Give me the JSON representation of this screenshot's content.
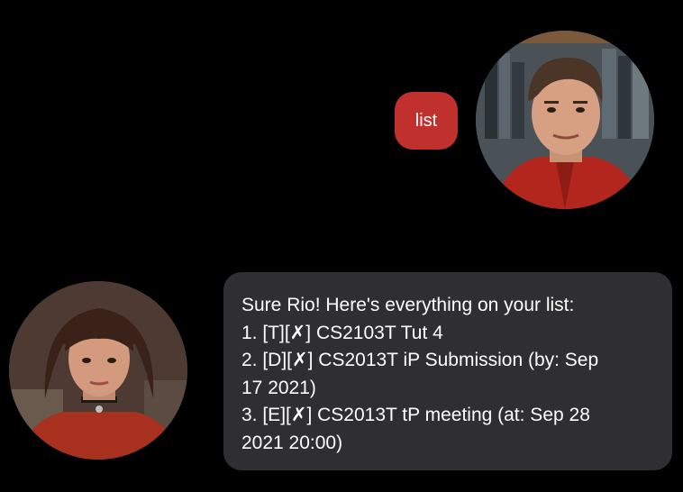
{
  "user_message": {
    "text": "list",
    "color": "#c0302c"
  },
  "bot_message": {
    "color": "#2f2f33",
    "lines": [
      "Sure Rio! Here's everything on your list:",
      "1. [T][✗] CS2103T Tut 4",
      "2. [D][✗] CS2013T iP Submission (by: Sep",
      "17 2021)",
      "3. [E][✗] CS2013T tP meeting (at: Sep 28",
      "2021 20:00)"
    ]
  },
  "avatars": {
    "user": "user-avatar-photo",
    "bot": "bot-avatar-photo"
  }
}
